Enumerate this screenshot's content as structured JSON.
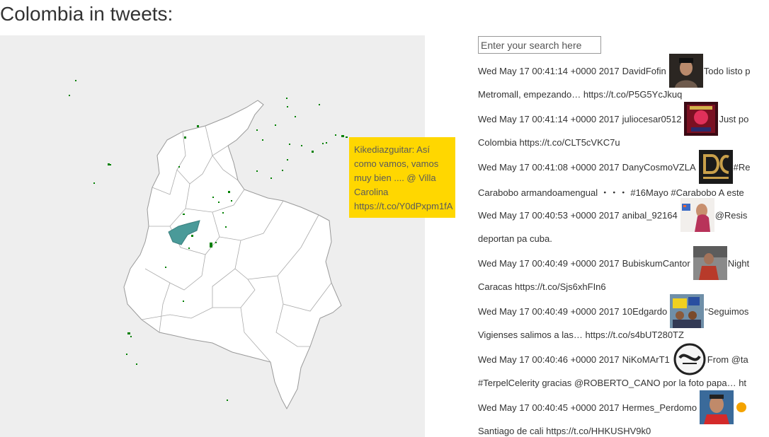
{
  "page": {
    "title": "Colombia in tweets:"
  },
  "map": {
    "background": "#eeeeee",
    "land_color": "#ffffff",
    "border_color": "#999999",
    "dot_color": "#008000",
    "highlight_color": "#4a9a99"
  },
  "tooltip": {
    "text": "Kikediazguitar: Así como vamos, vamos muy bien .... @ Villa Carolina https://t.co/Y0dPxpm1fA",
    "background": "#ffd700"
  },
  "search": {
    "placeholder": "Enter your search here",
    "value": ""
  },
  "tweets": [
    {
      "date": "Wed May 17 00:41:14 +0000 2017",
      "user": "DavidFofin",
      "avatar_icon": "user-photo-icon",
      "text_start": "Todo listo p",
      "text_end": "Metromall, empezando… https://t.co/P5G5YcJkuq"
    },
    {
      "date": "Wed May 17 00:41:14 +0000 2017",
      "user": "juliocesar0512",
      "avatar_icon": "user-photo-icon",
      "text_start": "Just po",
      "text_end": "Colombia https://t.co/CLT5cVKC7u"
    },
    {
      "date": "Wed May 17 00:41:08 +0000 2017",
      "user": "DanyCosmoVZLA",
      "avatar_icon": "dc-logo-icon",
      "text_start": "#Re",
      "text_end": "Carabobo armandoamengual ・・・ #16Mayo #Carabobo A este"
    },
    {
      "date": "Wed May 17 00:40:53 +0000 2017",
      "user": "anibal_92164",
      "avatar_icon": "user-photo-icon",
      "text_start": "@Resis",
      "text_end": "deportan pa cuba."
    },
    {
      "date": "Wed May 17 00:40:49 +0000 2017",
      "user": "BubiskumCantor",
      "avatar_icon": "user-photo-icon",
      "text_start": "Night",
      "text_end": "Caracas https://t.co/Sjs6xhFIn6"
    },
    {
      "date": "Wed May 17 00:40:49 +0000 2017",
      "user": "10Edgardo",
      "avatar_icon": "user-photo-icon",
      "text_start": "“Seguimos",
      "text_end": "Vigienses salimos a las… https://t.co/s4bUT280TZ"
    },
    {
      "date": "Wed May 17 00:40:46 +0000 2017",
      "user": "NiKoMArT1",
      "avatar_icon": "destiny-logo-icon",
      "text_start": "From @ta",
      "text_end": "#TerpelCelerity gracias @ROBERTO_CANO por la foto papa… ht"
    },
    {
      "date": "Wed May 17 00:40:45 +0000 2017",
      "user": "Hermes_Perdomo",
      "avatar_icon": "user-photo-icon",
      "text_start": "",
      "text_end": "Santiago de cali https://t.co/HHKUSHV9k0"
    }
  ]
}
